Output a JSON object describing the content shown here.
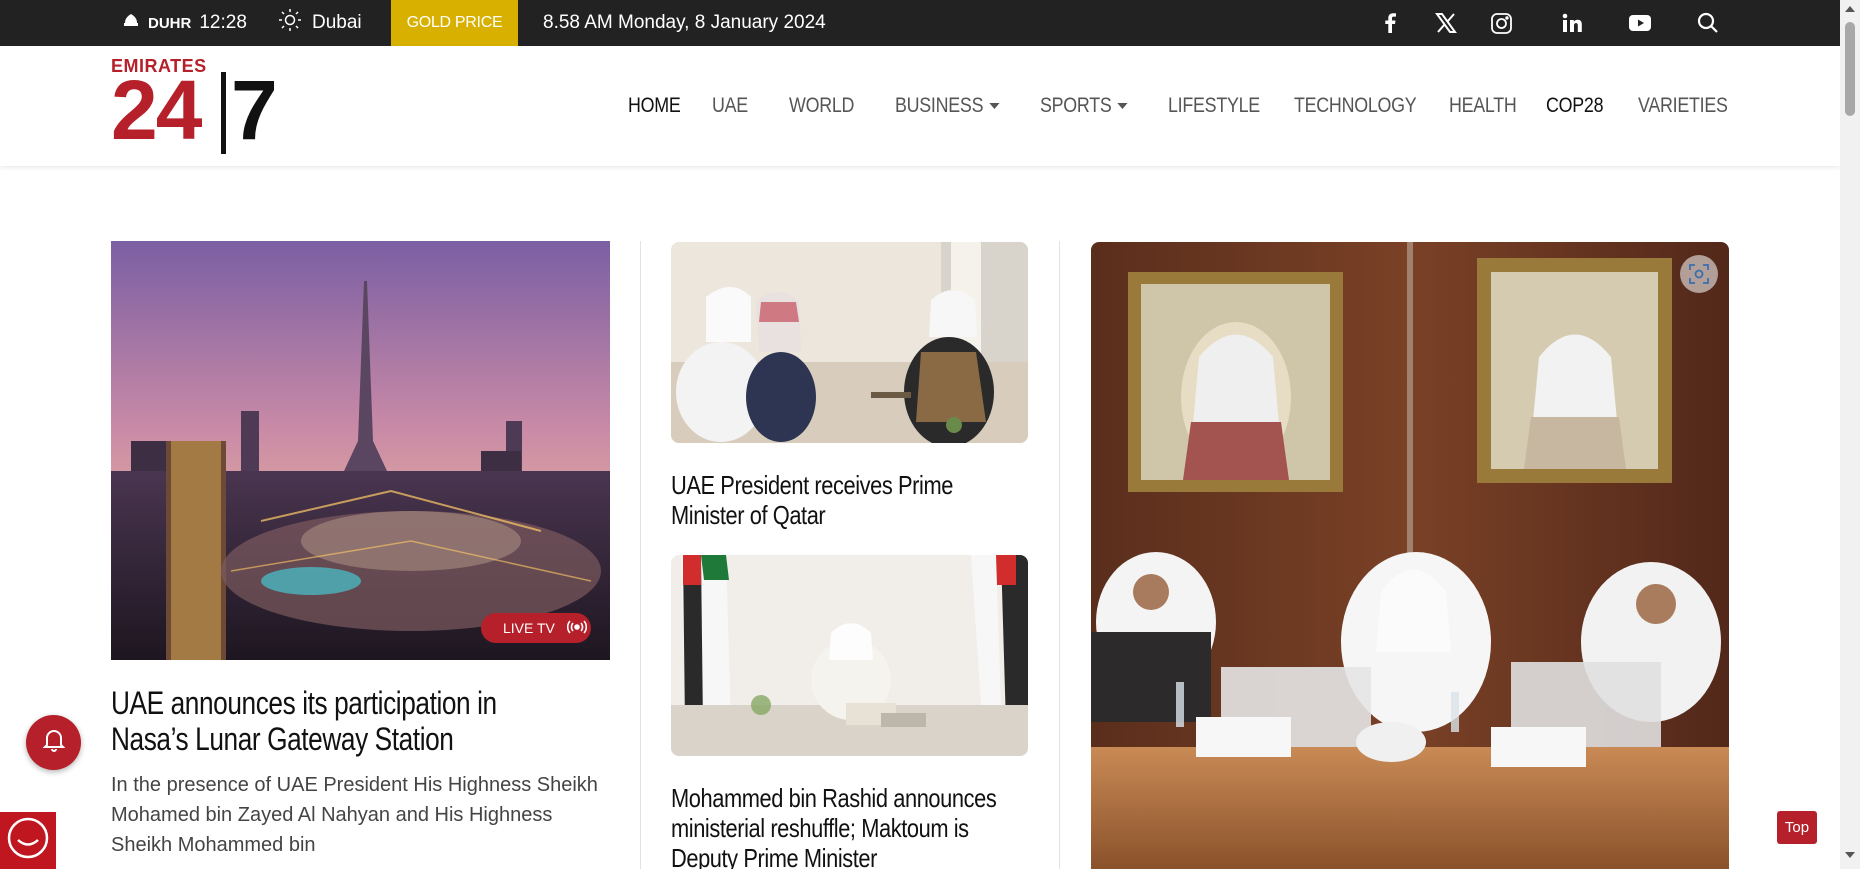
{
  "topbar": {
    "prayer_label": "DUHR",
    "prayer_time": "12:28",
    "weather_city": "Dubai",
    "gold_price_label": "GOLD PRICE",
    "datetime": "8.58 AM Monday, 8 January 2024",
    "social": [
      "facebook-icon",
      "x-icon",
      "instagram-icon",
      "linkedin-icon",
      "youtube-icon",
      "search-icon"
    ]
  },
  "logo": {
    "top_text": "EMIRATES",
    "number": "24",
    "seven": "7"
  },
  "nav": {
    "items": [
      {
        "label": "HOME",
        "active": true
      },
      {
        "label": "UAE"
      },
      {
        "label": "WORLD"
      },
      {
        "label": "BUSINESS",
        "dropdown": true
      },
      {
        "label": "SPORTS",
        "dropdown": true
      },
      {
        "label": "LIFESTYLE"
      },
      {
        "label": "TECHNOLOGY"
      },
      {
        "label": "HEALTH"
      },
      {
        "label": "COP28",
        "active": true
      },
      {
        "label": "VARIETIES"
      }
    ]
  },
  "articles": {
    "lead": {
      "title": "UAE announces its participation in Nasa’s Lunar Gateway Station",
      "summary": "In the presence of UAE President His Highness Sheikh Mohamed bin Zayed Al Nahyan and His Highness Sheikh Mohammed bin",
      "badge": "LIVE TV"
    },
    "second": {
      "title": "UAE President receives Prime Minister of Qatar"
    },
    "third": {
      "title": "Mohammed bin Rashid announces ministerial reshuffle; Maktoum is Deputy Prime Minister"
    }
  },
  "widgets": {
    "top_label": "Top"
  },
  "colors": {
    "brand_red": "#b5202a",
    "gold": "#d8b000",
    "topbar_bg": "#222222"
  }
}
